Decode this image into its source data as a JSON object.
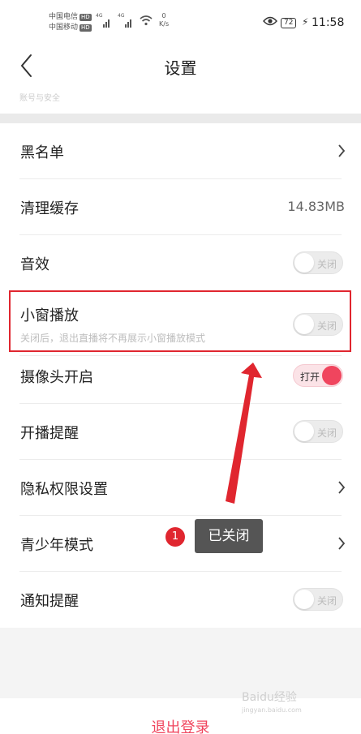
{
  "status_bar": {
    "carrier1": "中国电信",
    "carrier2": "中国移动",
    "hd": "HD",
    "net1": "4G",
    "net2": "4G",
    "speed_value": "0",
    "speed_unit": "K/s",
    "battery": "72",
    "time": "11:58"
  },
  "nav": {
    "title": "设置",
    "ghost_text": "账号与安全"
  },
  "rows": [
    {
      "label": "黑名单",
      "type": "chevron"
    },
    {
      "label": "清理缓存",
      "type": "value",
      "value": "14.83MB"
    },
    {
      "label": "音效",
      "type": "toggle",
      "toggle_text": "关闭",
      "on": false
    },
    {
      "label": "小窗播放",
      "type": "toggle",
      "toggle_text": "关闭",
      "on": false,
      "sub": "关闭后，退出直播将不再展示小窗播放模式"
    },
    {
      "label": "摄像头开启",
      "type": "toggle",
      "toggle_text": "打开",
      "on": true
    },
    {
      "label": "开播提醒",
      "type": "toggle",
      "toggle_text": "关闭",
      "on": false
    },
    {
      "label": "隐私权限设置",
      "type": "chevron"
    },
    {
      "label": "青少年模式",
      "type": "chevron"
    },
    {
      "label": "通知提醒",
      "type": "toggle",
      "toggle_text": "关闭",
      "on": false
    }
  ],
  "logout_label": "退出登录",
  "annotation": {
    "step": "1",
    "tooltip": "已关闭"
  },
  "watermark": {
    "main": "Baidu经验",
    "sub": "jingyan.baidu.com"
  },
  "colors": {
    "accent": "#f0455e",
    "highlight": "#e0262f"
  }
}
